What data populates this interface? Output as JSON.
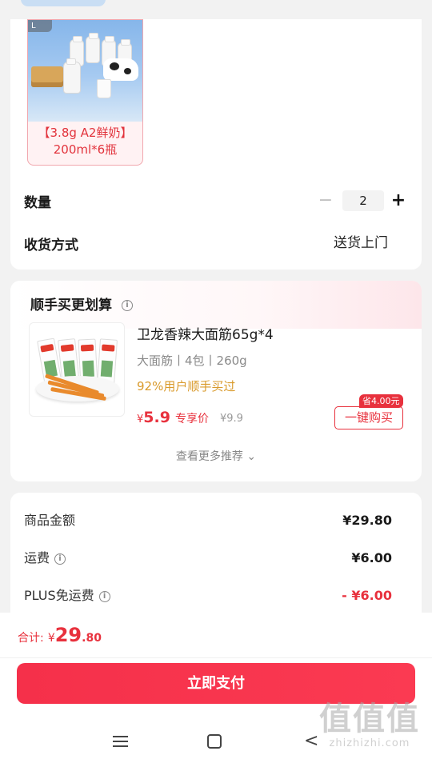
{
  "product": {
    "image_tag": "L",
    "caption_line1": "【3.8g A2鲜奶】",
    "caption_line2": "200ml*6瓶"
  },
  "quantity": {
    "label": "数量",
    "minus": "−",
    "value": "2",
    "plus": "+"
  },
  "delivery": {
    "label": "收货方式",
    "value": "送货上门"
  },
  "recommend": {
    "title": "顺手买更划算",
    "info_icon": "ⓘ",
    "item": {
      "name": "卫龙香辣大面筋65g*4",
      "spec": "大面筋丨4包丨260g",
      "popular": "92%用户顺手买过",
      "price_currency": "¥",
      "price": "5.9",
      "price_tag": "专享价",
      "old_price": "¥9.9",
      "save_badge": "省4.00元",
      "buy_label": "一键购买"
    },
    "more": "查看更多推荐 ⌄"
  },
  "fees": [
    {
      "label": "商品金额",
      "value": "¥29.80",
      "has_info": false,
      "red": false
    },
    {
      "label": "运费",
      "value": "¥6.00",
      "has_info": true,
      "red": false
    },
    {
      "label": "PLUS免运费",
      "value": "- ¥6.00",
      "has_info": true,
      "red": true
    }
  ],
  "total": {
    "label": "合计:",
    "currency": "¥",
    "integer": "29",
    "decimal": ".80"
  },
  "pay_button": "立即支付",
  "watermark": {
    "big": "值值值",
    "small": "zhizhizhi.com"
  },
  "colors": {
    "accent": "#e8313d",
    "pay_button": "#f5304a",
    "popular": "#d99a2b"
  }
}
